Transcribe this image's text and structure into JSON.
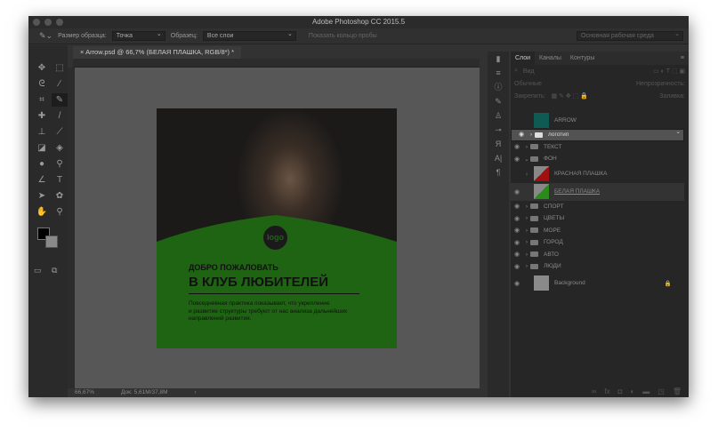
{
  "window": {
    "title": "Adobe Photoshop CC 2015.5"
  },
  "options": {
    "sample_size_label": "Размер образца:",
    "sample_size_value": "Точка",
    "sample_label": "Образец:",
    "sample_value": "Все слои",
    "show_ring": "Показать кольцо пробы",
    "workspace": "Основная рабочая среда"
  },
  "document": {
    "tab": "Arrow.psd @ 66,7% (БЕЛАЯ ПЛАШКА, RGB/8*) *",
    "zoom": "66,67%",
    "doc_size": "Док: 5,61M/37,8M"
  },
  "artwork": {
    "logo": "logo",
    "heading_small": "ДОБРО ПОЖАЛОВАТЬ",
    "heading_large": "В КЛУБ ЛЮБИТЕЛЕЙ",
    "body_lines": [
      "Повседневная практика показывает, что укрепление",
      "и развитие структуры требуют от нас анализа дальнейших",
      "направлений развития."
    ],
    "green": "#1e6412"
  },
  "panel": {
    "tabs": [
      "Слои",
      "Каналы",
      "Контуры"
    ],
    "search_placeholder": "Вид",
    "blend_mode": "Обычные",
    "opacity_label": "Непрозрачность:",
    "lock_label": "Закрепить:",
    "fill_label": "Заливка:"
  },
  "layers": [
    {
      "name": "ARROW",
      "type": "image",
      "visible": false,
      "thumb": "#0f5a52"
    },
    {
      "name": "логотип",
      "type": "group",
      "visible": true,
      "selected": true
    },
    {
      "name": "ТЕКСТ",
      "type": "group",
      "visible": true
    },
    {
      "name": "ФОН",
      "type": "group-open",
      "visible": true
    },
    {
      "name": "КРАСНАЯ ПЛАШКА",
      "type": "image",
      "visible": false,
      "thumb": "#a01010",
      "clipped": true
    },
    {
      "name": "БЕЛАЯ ПЛАШКА",
      "type": "image",
      "visible": true,
      "thumb": "#2a8a1a",
      "active": true
    },
    {
      "name": "СПОРТ",
      "type": "group",
      "visible": true
    },
    {
      "name": "ЦВЕТЫ",
      "type": "group",
      "visible": true
    },
    {
      "name": "МОРЕ",
      "type": "group",
      "visible": true
    },
    {
      "name": "ГОРОД",
      "type": "group",
      "visible": true
    },
    {
      "name": "АВТО",
      "type": "group",
      "visible": true
    },
    {
      "name": "ЛЮДИ",
      "type": "group",
      "visible": true
    },
    {
      "name": "Background",
      "type": "image",
      "visible": true,
      "thumb": "#8a8a8a",
      "locked": true
    }
  ]
}
